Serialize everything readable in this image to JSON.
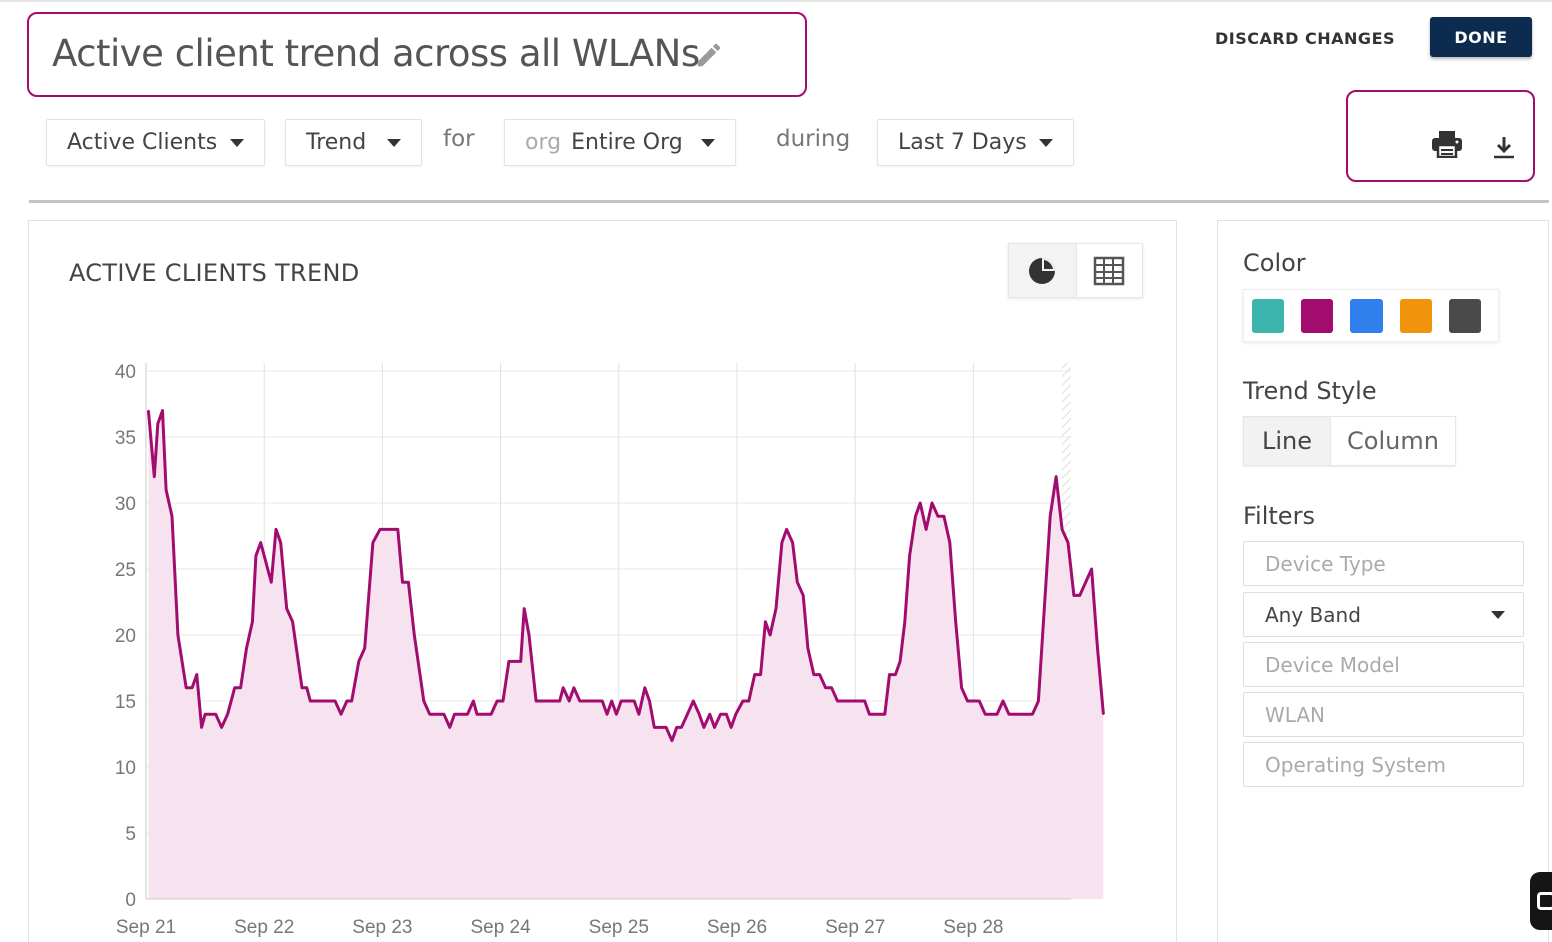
{
  "report": {
    "title": "Active client trend across all WLANs",
    "discard_label": "DISCARD CHANGES",
    "done_label": "DONE"
  },
  "query": {
    "metric": "Active Clients",
    "view": "Trend",
    "for_label": "for",
    "scope_prefix": "org",
    "scope": "Entire Org",
    "during_label": "during",
    "period": "Last 7 Days"
  },
  "panel": {
    "title": "ACTIVE CLIENTS TREND"
  },
  "side": {
    "color_label": "Color",
    "colors": [
      "#3ab4ad",
      "#a20c6e",
      "#2f80ed",
      "#f2930c",
      "#4a4a4a"
    ],
    "trend_style_label": "Trend Style",
    "styles": [
      "Line",
      "Column"
    ],
    "selected_style": "Line",
    "filters_label": "Filters",
    "filters": {
      "device_type": "Device Type",
      "band": "Any Band",
      "device_model": "Device Model",
      "wlan": "WLAN",
      "os": "Operating System"
    }
  },
  "icons": {
    "edit": "pencil-icon",
    "print": "printer-icon",
    "download": "download-icon",
    "pie": "pie-chart-icon",
    "table": "table-icon"
  },
  "chart_data": {
    "type": "area",
    "title": "",
    "xlabel": "",
    "ylabel": "",
    "color": "#a20c6e",
    "fill": "#f6e3ef",
    "ylim": [
      0,
      40
    ],
    "yticks": [
      0,
      5,
      10,
      15,
      20,
      25,
      30,
      35,
      40
    ],
    "xlim": [
      0,
      7.8
    ],
    "x_ticks": [
      {
        "x": 0,
        "label": "Sep 21"
      },
      {
        "x": 1,
        "label": "Sep 22"
      },
      {
        "x": 2,
        "label": "Sep 23"
      },
      {
        "x": 3,
        "label": "Sep 24"
      },
      {
        "x": 4,
        "label": "Sep 25"
      },
      {
        "x": 5,
        "label": "Sep 26"
      },
      {
        "x": 6,
        "label": "Sep 27"
      },
      {
        "x": 7,
        "label": "Sep 28"
      }
    ],
    "grid": true,
    "series": [
      {
        "points": [
          [
            0.02,
            37
          ],
          [
            0.07,
            32
          ],
          [
            0.1,
            36
          ],
          [
            0.14,
            37
          ],
          [
            0.17,
            31
          ],
          [
            0.22,
            29
          ],
          [
            0.27,
            20
          ],
          [
            0.34,
            16
          ],
          [
            0.39,
            16
          ],
          [
            0.43,
            17
          ],
          [
            0.47,
            13
          ],
          [
            0.5,
            14
          ],
          [
            0.55,
            14
          ],
          [
            0.59,
            14
          ],
          [
            0.64,
            13
          ],
          [
            0.69,
            14
          ],
          [
            0.75,
            16
          ],
          [
            0.8,
            16
          ],
          [
            0.85,
            19
          ],
          [
            0.9,
            21
          ],
          [
            0.93,
            26
          ],
          [
            0.97,
            27
          ],
          [
            1.03,
            25
          ],
          [
            1.06,
            24
          ],
          [
            1.1,
            28
          ],
          [
            1.14,
            27
          ],
          [
            1.19,
            22
          ],
          [
            1.24,
            21
          ],
          [
            1.32,
            16
          ],
          [
            1.36,
            16
          ],
          [
            1.39,
            15
          ],
          [
            1.44,
            15
          ],
          [
            1.51,
            15
          ],
          [
            1.6,
            15
          ],
          [
            1.65,
            14
          ],
          [
            1.7,
            15
          ],
          [
            1.74,
            15
          ],
          [
            1.8,
            18
          ],
          [
            1.85,
            19
          ],
          [
            1.92,
            27
          ],
          [
            1.98,
            28
          ],
          [
            2.05,
            28
          ],
          [
            2.13,
            28
          ],
          [
            2.17,
            24
          ],
          [
            2.22,
            24
          ],
          [
            2.27,
            20
          ],
          [
            2.35,
            15
          ],
          [
            2.4,
            14
          ],
          [
            2.45,
            14
          ],
          [
            2.52,
            14
          ],
          [
            2.57,
            13
          ],
          [
            2.61,
            14
          ],
          [
            2.67,
            14
          ],
          [
            2.72,
            14
          ],
          [
            2.77,
            15
          ],
          [
            2.8,
            14
          ],
          [
            2.85,
            14
          ],
          [
            2.92,
            14
          ],
          [
            2.97,
            15
          ],
          [
            3.02,
            15
          ],
          [
            3.07,
            18
          ],
          [
            3.13,
            18
          ],
          [
            3.17,
            18
          ],
          [
            3.2,
            22
          ],
          [
            3.24,
            20
          ],
          [
            3.3,
            15
          ],
          [
            3.35,
            15
          ],
          [
            3.4,
            15
          ],
          [
            3.45,
            15
          ],
          [
            3.5,
            15
          ],
          [
            3.53,
            16
          ],
          [
            3.58,
            15
          ],
          [
            3.62,
            16
          ],
          [
            3.67,
            15
          ],
          [
            3.72,
            15
          ],
          [
            3.8,
            15
          ],
          [
            3.86,
            15
          ],
          [
            3.9,
            14
          ],
          [
            3.94,
            15
          ],
          [
            3.98,
            14
          ],
          [
            4.02,
            15
          ],
          [
            4.08,
            15
          ],
          [
            4.13,
            15
          ],
          [
            4.17,
            14
          ],
          [
            4.22,
            16
          ],
          [
            4.26,
            15
          ],
          [
            4.3,
            13
          ],
          [
            4.35,
            13
          ],
          [
            4.4,
            13
          ],
          [
            4.45,
            12
          ],
          [
            4.49,
            13
          ],
          [
            4.53,
            13
          ],
          [
            4.58,
            14
          ],
          [
            4.63,
            15
          ],
          [
            4.68,
            14
          ],
          [
            4.72,
            13
          ],
          [
            4.77,
            14
          ],
          [
            4.81,
            13
          ],
          [
            4.86,
            14
          ],
          [
            4.91,
            14
          ],
          [
            4.95,
            13
          ],
          [
            4.99,
            14
          ],
          [
            5.05,
            15
          ],
          [
            5.1,
            15
          ],
          [
            5.15,
            17
          ],
          [
            5.2,
            17
          ],
          [
            5.24,
            21
          ],
          [
            5.28,
            20
          ],
          [
            5.33,
            22
          ],
          [
            5.38,
            27
          ],
          [
            5.42,
            28
          ],
          [
            5.47,
            27
          ],
          [
            5.51,
            24
          ],
          [
            5.56,
            23
          ],
          [
            5.6,
            19
          ],
          [
            5.65,
            17
          ],
          [
            5.7,
            17
          ],
          [
            5.75,
            16
          ],
          [
            5.8,
            16
          ],
          [
            5.85,
            15
          ],
          [
            5.9,
            15
          ],
          [
            6.0,
            15
          ],
          [
            6.08,
            15
          ],
          [
            6.12,
            14
          ],
          [
            6.2,
            14
          ],
          [
            6.25,
            14
          ],
          [
            6.29,
            17
          ],
          [
            6.34,
            17
          ],
          [
            6.38,
            18
          ],
          [
            6.42,
            21
          ],
          [
            6.46,
            26
          ],
          [
            6.51,
            29
          ],
          [
            6.55,
            30
          ],
          [
            6.6,
            28
          ],
          [
            6.65,
            30
          ],
          [
            6.7,
            29
          ],
          [
            6.75,
            29
          ],
          [
            6.8,
            27
          ],
          [
            6.85,
            21
          ],
          [
            6.9,
            16
          ],
          [
            6.95,
            15
          ],
          [
            7.0,
            15
          ],
          [
            7.05,
            15
          ],
          [
            7.1,
            14
          ],
          [
            7.15,
            14
          ],
          [
            7.2,
            14
          ],
          [
            7.25,
            15
          ],
          [
            7.3,
            14
          ],
          [
            7.35,
            14
          ],
          [
            7.4,
            14
          ],
          [
            7.45,
            14
          ],
          [
            7.5,
            14
          ],
          [
            7.55,
            15
          ],
          [
            7.6,
            22
          ],
          [
            7.65,
            29
          ],
          [
            7.7,
            32
          ],
          [
            7.75,
            28
          ],
          [
            7.8,
            27
          ],
          [
            7.85,
            23
          ],
          [
            7.9,
            23
          ],
          [
            7.95,
            24
          ],
          [
            8.0,
            25
          ],
          [
            8.05,
            19
          ],
          [
            8.1,
            14
          ]
        ]
      }
    ]
  }
}
